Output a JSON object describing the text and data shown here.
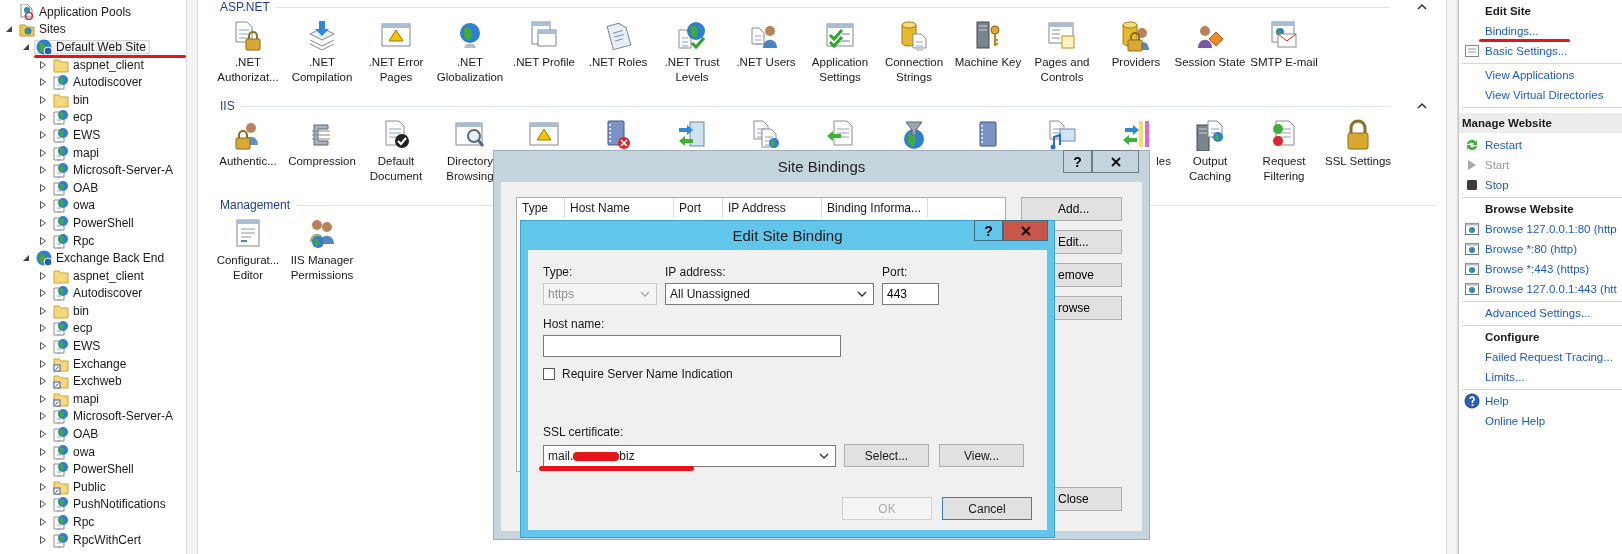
{
  "tree": {
    "items": [
      {
        "label": "Application Pools",
        "kind": "pools",
        "selected": false
      },
      {
        "label": "Sites",
        "kind": "sites",
        "expanded": true,
        "selected": false,
        "children": [
          {
            "label": "Default Web Site",
            "kind": "site",
            "expanded": true,
            "selected": true,
            "children": [
              {
                "label": "aspnet_client",
                "kind": "folder",
                "expanded": false,
                "selected": false
              },
              {
                "label": "Autodiscover",
                "kind": "app",
                "expanded": false,
                "selected": false
              },
              {
                "label": "bin",
                "kind": "folder",
                "expanded": false,
                "selected": false
              },
              {
                "label": "ecp",
                "kind": "app",
                "expanded": false,
                "selected": false
              },
              {
                "label": "EWS",
                "kind": "app",
                "expanded": false,
                "selected": false
              },
              {
                "label": "mapi",
                "kind": "app",
                "expanded": false,
                "selected": false
              },
              {
                "label": "Microsoft-Server-A",
                "kind": "app",
                "expanded": false,
                "selected": false
              },
              {
                "label": "OAB",
                "kind": "app",
                "expanded": false,
                "selected": false
              },
              {
                "label": "owa",
                "kind": "app",
                "expanded": false,
                "selected": false
              },
              {
                "label": "PowerShell",
                "kind": "app",
                "expanded": false,
                "selected": false
              },
              {
                "label": "Rpc",
                "kind": "app",
                "expanded": false,
                "selected": false
              }
            ]
          },
          {
            "label": "Exchange Back End",
            "kind": "site",
            "expanded": true,
            "selected": false,
            "children": [
              {
                "label": "aspnet_client",
                "kind": "folder",
                "expanded": false,
                "selected": false
              },
              {
                "label": "Autodiscover",
                "kind": "app",
                "expanded": false,
                "selected": false
              },
              {
                "label": "bin",
                "kind": "folder",
                "expanded": false,
                "selected": false
              },
              {
                "label": "ecp",
                "kind": "app",
                "expanded": false,
                "selected": false
              },
              {
                "label": "EWS",
                "kind": "app",
                "expanded": false,
                "selected": false
              },
              {
                "label": "Exchange",
                "kind": "virtual",
                "expanded": false,
                "selected": false
              },
              {
                "label": "Exchweb",
                "kind": "virtual",
                "expanded": false,
                "selected": false
              },
              {
                "label": "mapi",
                "kind": "virtual",
                "expanded": false,
                "selected": false
              },
              {
                "label": "Microsoft-Server-A",
                "kind": "app",
                "expanded": false,
                "selected": false
              },
              {
                "label": "OAB",
                "kind": "app",
                "expanded": false,
                "selected": false
              },
              {
                "label": "owa",
                "kind": "app",
                "expanded": false,
                "selected": false
              },
              {
                "label": "PowerShell",
                "kind": "app",
                "expanded": false,
                "selected": false
              },
              {
                "label": "Public",
                "kind": "virtual",
                "expanded": false,
                "selected": false
              },
              {
                "label": "PushNotifications",
                "kind": "app",
                "expanded": false,
                "selected": false
              },
              {
                "label": "Rpc",
                "kind": "app",
                "expanded": false,
                "selected": false
              },
              {
                "label": "RpcWithCert",
                "kind": "app",
                "expanded": false,
                "selected": false
              }
            ]
          }
        ]
      }
    ]
  },
  "features": {
    "sections": [
      {
        "title": "ASP.NET",
        "collapsible": true,
        "items": [
          {
            "kind": "tile",
            "label": ".NET Authorizat..."
          },
          {
            "kind": "tile",
            "label": ".NET Compilation"
          },
          {
            "kind": "tile",
            "label": ".NET Error Pages"
          },
          {
            "kind": "tile",
            "label": ".NET Globalization"
          },
          {
            "kind": "tile",
            "label": ".NET Profile"
          },
          {
            "kind": "tile",
            "label": ".NET Roles"
          },
          {
            "kind": "tile",
            "label": ".NET Trust Levels"
          },
          {
            "kind": "tile",
            "label": ".NET Users"
          },
          {
            "kind": "tile",
            "label": "Application Settings"
          },
          {
            "kind": "tile",
            "label": "Connection Strings"
          },
          {
            "kind": "tile",
            "label": "Machine Key"
          },
          {
            "kind": "tile",
            "label": "Pages and Controls"
          },
          {
            "kind": "tile",
            "label": "Providers"
          },
          {
            "kind": "tile",
            "label": "Session State"
          },
          {
            "kind": "tile",
            "label": "SMTP E-mail"
          }
        ]
      },
      {
        "title": "IIS",
        "collapsible": true,
        "items": [
          {
            "kind": "tile",
            "label": "Authentic..."
          },
          {
            "kind": "tile",
            "label": "Compression"
          },
          {
            "kind": "tile",
            "label": "Default Document"
          },
          {
            "kind": "tile",
            "label": "Directory Browsing"
          },
          {
            "kind": "covered"
          },
          {
            "kind": "covered"
          },
          {
            "kind": "covered"
          },
          {
            "kind": "covered"
          },
          {
            "kind": "covered"
          },
          {
            "kind": "covered"
          },
          {
            "kind": "covered"
          },
          {
            "kind": "covered"
          },
          {
            "kind": "partly-covered",
            "label": "les"
          },
          {
            "kind": "tile",
            "label": "Output Caching"
          },
          {
            "kind": "tile",
            "label": "Request Filtering"
          },
          {
            "kind": "tile",
            "label": "SSL Settings"
          }
        ]
      },
      {
        "title": "Management",
        "collapsible": false,
        "items": [
          {
            "kind": "tile",
            "label": "Configurat... Editor"
          },
          {
            "kind": "tile",
            "label": "IIS Manager Permissions"
          }
        ]
      }
    ]
  },
  "actions": {
    "groups": [
      {
        "items": [
          {
            "kind": "heading",
            "label": "Edit Site"
          },
          {
            "kind": "link",
            "label": "Bindings...",
            "disabled": false
          },
          {
            "kind": "settings-link",
            "label": "Basic Settings...",
            "disabled": false
          }
        ]
      },
      {
        "items": [
          {
            "kind": "link",
            "label": "View Applications",
            "disabled": false
          },
          {
            "kind": "link",
            "label": "View Virtual Directories",
            "disabled": false
          }
        ]
      },
      {
        "items": [
          {
            "kind": "section",
            "label": "Manage Website"
          },
          {
            "kind": "restart",
            "label": "Restart",
            "disabled": false
          },
          {
            "kind": "start",
            "label": "Start",
            "disabled": true
          },
          {
            "kind": "stop",
            "label": "Stop",
            "disabled": false
          }
        ]
      },
      {
        "items": [
          {
            "kind": "heading",
            "label": "Browse Website"
          },
          {
            "kind": "browse",
            "label": "Browse 127.0.0.1:80 (http",
            "disabled": false
          },
          {
            "kind": "browse",
            "label": "Browse *:80 (http)",
            "disabled": false
          },
          {
            "kind": "browse",
            "label": "Browse *:443 (https)",
            "disabled": false
          },
          {
            "kind": "browse",
            "label": "Browse 127.0.0.1:443 (htt",
            "disabled": false
          }
        ]
      },
      {
        "items": [
          {
            "kind": "link",
            "label": "Advanced Settings...",
            "disabled": false
          }
        ]
      },
      {
        "items": [
          {
            "kind": "heading",
            "label": "Configure"
          },
          {
            "kind": "link",
            "label": "Failed Request Tracing...",
            "disabled": false
          },
          {
            "kind": "link",
            "label": "Limits...",
            "disabled": false
          }
        ]
      },
      {
        "items": [
          {
            "kind": "help",
            "label": "Help",
            "disabled": false
          },
          {
            "kind": "link",
            "label": "Online Help",
            "disabled": false
          }
        ]
      }
    ]
  },
  "site_bindings_dialog": {
    "title": "Site Bindings",
    "help_button": "?",
    "columns": [
      "Type",
      "Host Name",
      "Port",
      "IP Address",
      "Binding Informa..."
    ],
    "buttons": [
      "Add...",
      "Edit...",
      "emove",
      "rowse"
    ],
    "close_button": "Close"
  },
  "edit_site_binding_dialog": {
    "title": "Edit Site Binding",
    "help_button": "?",
    "type": {
      "label": "Type:",
      "value": "https",
      "disabled": true
    },
    "ip_address": {
      "label": "IP address:",
      "value": "All Unassigned"
    },
    "port": {
      "label": "Port:",
      "value": "443"
    },
    "host_name": {
      "label": "Host name:"
    },
    "require_sni": {
      "label": "Require Server Name Indication",
      "checked": false
    },
    "ssl_certificate": {
      "label": "SSL certificate:",
      "value_start": "mail.",
      "redacted": true,
      "value_end": "biz"
    },
    "select_button": "Select...",
    "view_button": "View...",
    "ok_button": {
      "label": "OK",
      "disabled": true
    },
    "cancel_button": "Cancel"
  }
}
